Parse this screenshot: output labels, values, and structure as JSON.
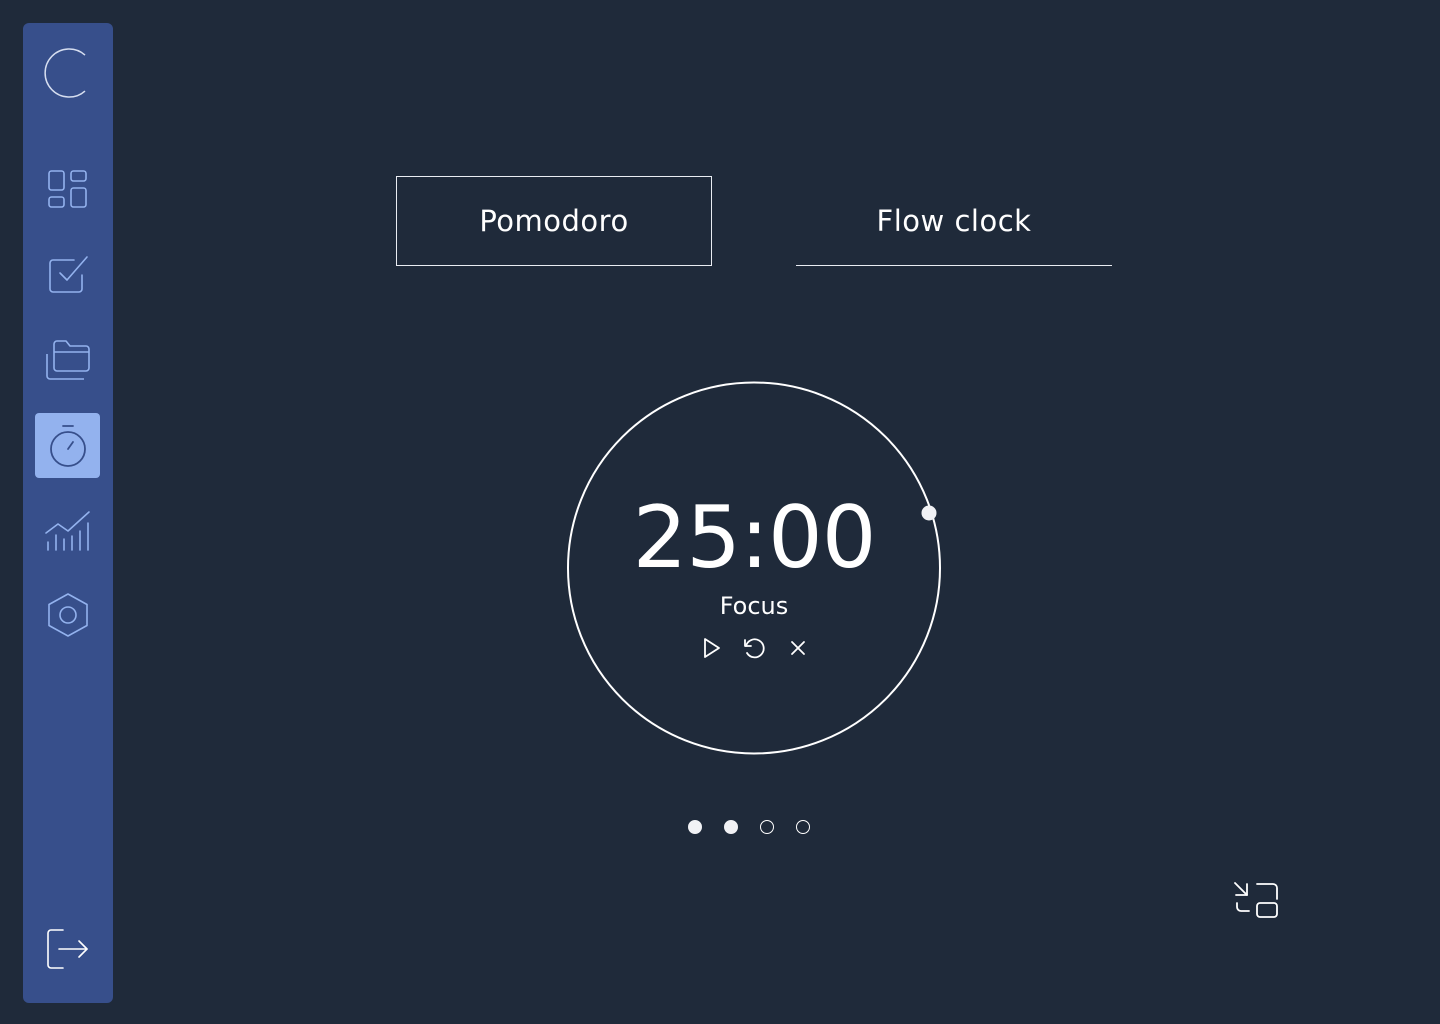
{
  "sidebar": {
    "items": [
      {
        "icon": "dashboard-icon",
        "active": false
      },
      {
        "icon": "tasks-checkbox-icon",
        "active": false
      },
      {
        "icon": "folders-icon",
        "active": false
      },
      {
        "icon": "stopwatch-icon",
        "active": true
      },
      {
        "icon": "stats-chart-icon",
        "active": false
      },
      {
        "icon": "settings-hexagon-icon",
        "active": false
      }
    ],
    "logout_icon": "logout-icon",
    "logo_icon": "logo-arc-icon"
  },
  "tabs": [
    {
      "label": "Pomodoro",
      "active": true
    },
    {
      "label": "Flow clock",
      "active": false
    }
  ],
  "timer": {
    "time": "25:00",
    "mode": "Focus",
    "controls": [
      "play-icon",
      "reset-icon",
      "close-icon"
    ]
  },
  "session_dots": [
    {
      "filled": true
    },
    {
      "filled": true
    },
    {
      "filled": false
    },
    {
      "filled": false
    }
  ],
  "colors": {
    "background": "#1f2a3a",
    "sidebar": "#374f8b",
    "active_item": "#93b2ee",
    "icon_stroke": "#93b2ee",
    "text": "#ffffff"
  }
}
